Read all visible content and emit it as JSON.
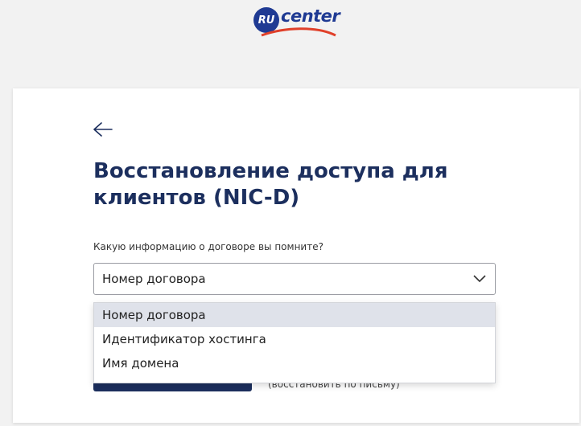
{
  "logo": {
    "ru": "RU",
    "text": "center"
  },
  "page": {
    "title": "Восстановление доступа для клиентов (NIC-D)",
    "question": "Какую информацию о договоре вы помните?"
  },
  "select": {
    "value": "Номер договора",
    "options": [
      "Номер договора",
      "Идентификатор хостинга",
      "Имя домена"
    ],
    "selected_index": 0
  },
  "alt_link": "(восстановить по письму)",
  "colors": {
    "brand": "#1f3a93",
    "title": "#1c2f5e",
    "accent_swoosh": "#e0402a",
    "option_selected_bg": "#dfe2ea"
  },
  "icons": {
    "back": "arrow-left-icon",
    "dropdown": "chevron-down-icon"
  }
}
